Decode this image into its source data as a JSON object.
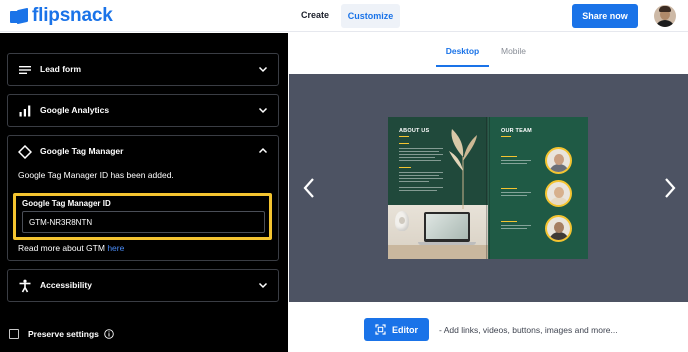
{
  "header": {
    "logo_text": "flipsnack",
    "nav": {
      "create": "Create",
      "customize": "Customize"
    },
    "share_button": "Share now"
  },
  "sidebar": {
    "sections": [
      {
        "title": "Lead form",
        "icon": "list-lines-icon",
        "expanded": false
      },
      {
        "title": "Google Analytics",
        "icon": "bar-chart-icon",
        "expanded": false
      },
      {
        "title": "Google Tag Manager",
        "icon": "diamond-tag-icon",
        "expanded": true
      },
      {
        "title": "Accessibility",
        "icon": "accessibility-person-icon",
        "expanded": false
      }
    ],
    "gtm": {
      "status_note": "Google Tag Manager ID has been added.",
      "field_label": "Google Tag Manager ID",
      "field_value": "GTM-NR3R8NTN",
      "read_more_prefix": "Read more about GTM",
      "read_more_link": "here"
    },
    "preserve_settings": {
      "label": "Preserve settings",
      "checked": false
    }
  },
  "preview": {
    "tabs": [
      {
        "label": "Desktop",
        "active": true
      },
      {
        "label": "Mobile",
        "active": false
      }
    ],
    "book": {
      "left_title": "ABOUT US",
      "right_title": "OUR TEAM",
      "members": 3
    },
    "editor_button": "Editor",
    "editor_hint": "- Add links, videos, buttons, images and more..."
  },
  "colors": {
    "accent": "#1a73e8",
    "highlight": "#f4c430",
    "panel_bg": "#000000",
    "stage_bg": "#4d5363",
    "page_green": "#20493b"
  }
}
